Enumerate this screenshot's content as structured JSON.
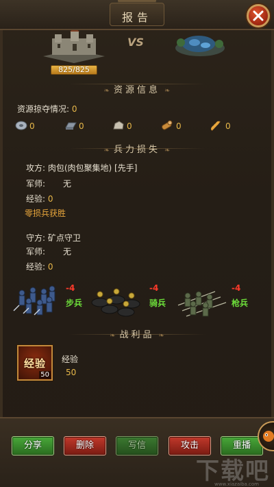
{
  "header": {
    "title": "报告"
  },
  "battle": {
    "hp_text": "825/825",
    "vs_text": "VS"
  },
  "resources": {
    "section_title": "资源信息",
    "plunder_label": "资源掠夺情况:",
    "plunder_value": "0",
    "items": [
      {
        "icon": "silver-coin-icon",
        "value": "0"
      },
      {
        "icon": "iron-ingot-icon",
        "value": "0"
      },
      {
        "icon": "stone-icon",
        "value": "0"
      },
      {
        "icon": "wood-log-icon",
        "value": "0"
      },
      {
        "icon": "grain-icon",
        "value": "0"
      }
    ]
  },
  "losses": {
    "section_title": "兵力损失",
    "attacker": {
      "side_label": "攻方:",
      "name": "肉包(肉包聚集地) [先手]",
      "advisor_label": "军师:",
      "advisor_value": "无",
      "exp_label": "经验:",
      "exp_value": "0",
      "result": "零损兵获胜"
    },
    "defender": {
      "side_label": "守方:",
      "name": "矿点守卫",
      "advisor_label": "军师:",
      "advisor_value": "无",
      "exp_label": "经验:",
      "exp_value": "0"
    },
    "units": [
      {
        "name": "步兵",
        "loss": "-4"
      },
      {
        "name": "骑兵",
        "loss": "-4"
      },
      {
        "name": "枪兵",
        "loss": "-4"
      }
    ]
  },
  "spoils": {
    "section_title": "战利品",
    "item_label": "经验",
    "item_count": "50",
    "name": "经验",
    "value": "50"
  },
  "footer": {
    "buttons": [
      "分享",
      "删除",
      "写信",
      "攻击",
      "重播"
    ]
  },
  "watermark": {
    "text": "下载吧",
    "url": "www.xiazaiba.com"
  },
  "colors": {
    "gold": "#e8b84a",
    "loss_red": "#ff3a2a",
    "unit_green": "#6cdc3a"
  }
}
